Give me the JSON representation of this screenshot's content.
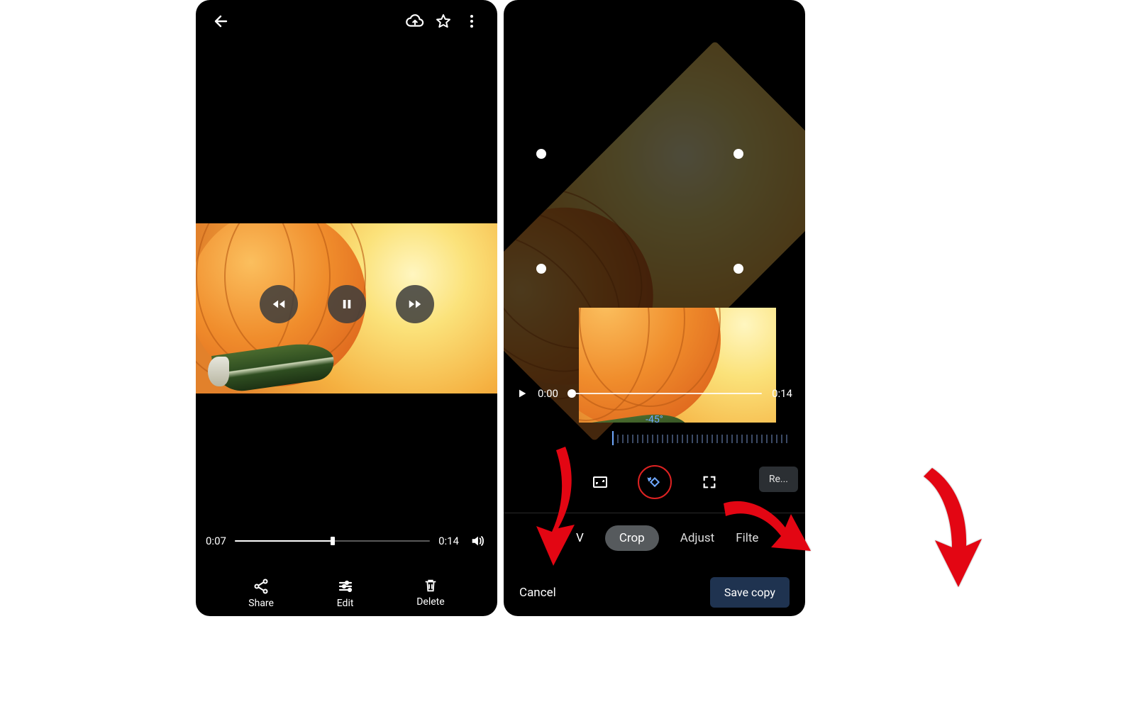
{
  "left": {
    "playback": {
      "elapsed": "0:07",
      "duration": "0:14",
      "progress_pct": 50
    },
    "actions": {
      "share": "Share",
      "edit": "Edit",
      "delete": "Delete"
    }
  },
  "right": {
    "playback": {
      "elapsed": "0:00",
      "duration": "0:14",
      "progress_pct": 2
    },
    "rotation_angle": "-45°",
    "reset_label": "Re...",
    "tabs": {
      "hint": "V",
      "crop": "Crop",
      "adjust": "Adjust",
      "filters": "Filte"
    },
    "cancel": "Cancel",
    "save": "Save copy"
  },
  "colors": {
    "accent_blue": "#6fa8ff",
    "arrow_red": "#e30613",
    "highlight_ring": "#d22222",
    "save_bg": "#1f3350"
  }
}
